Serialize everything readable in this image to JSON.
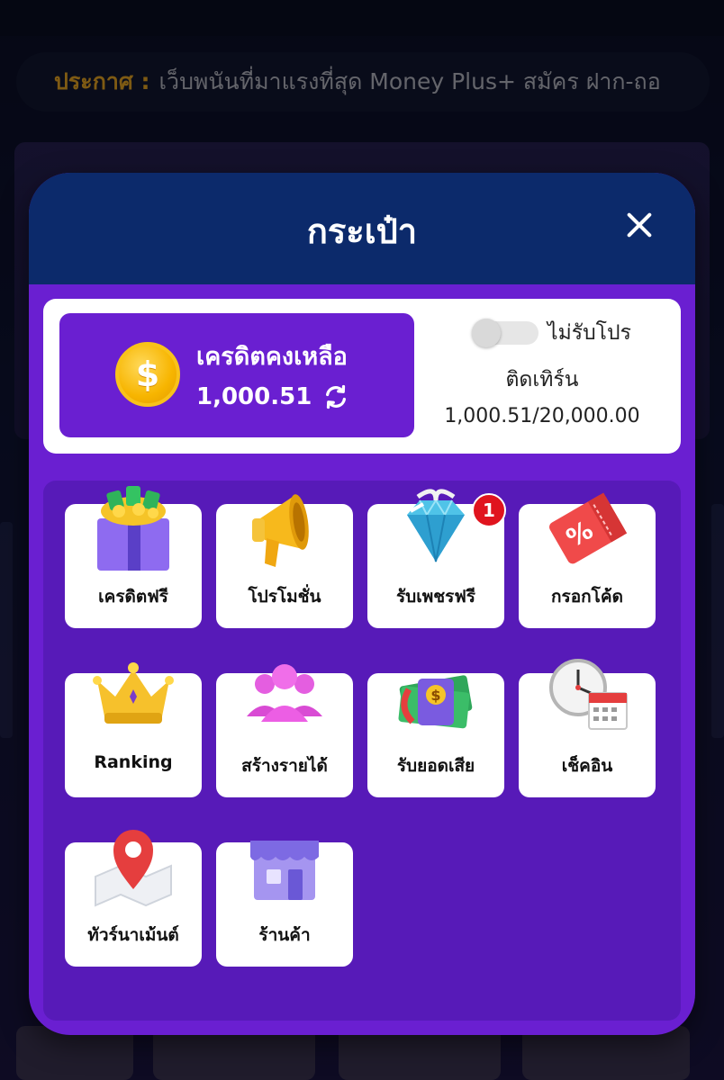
{
  "announcement": {
    "label": "ประกาศ :",
    "text": "เว็บพนันที่มาแรงที่สุด Money Plus+ สมัคร ฝาก-ถอ"
  },
  "wallet": {
    "title": "กระเป๋า",
    "close_icon": "close-icon",
    "credit_label": "เครดิตคงเหลือ",
    "credit_amount": "1,000.51",
    "promo_toggle_label": "ไม่รับโปร",
    "promo_toggle_on": false,
    "turnover_label": "ติดเทิร์น",
    "turnover_value": "1,000.51/20,000.00"
  },
  "menu": [
    {
      "label": "เครดิตฟรี",
      "icon": "gift-box-icon"
    },
    {
      "label": "โปรโมชั่น",
      "icon": "megaphone-icon"
    },
    {
      "label": "รับเพชรฟรี",
      "icon": "diamond-gift-icon",
      "badge": "1"
    },
    {
      "label": "กรอกโค้ด",
      "icon": "coupon-icon"
    },
    {
      "label": "Ranking",
      "icon": "crown-icon"
    },
    {
      "label": "สร้างรายได้",
      "icon": "users-icon"
    },
    {
      "label": "รับยอดเสีย",
      "icon": "cash-refund-icon"
    },
    {
      "label": "เช็คอิน",
      "icon": "clock-calendar-icon"
    },
    {
      "label": "ทัวร์นาเม้นต์",
      "icon": "map-pin-icon"
    },
    {
      "label": "ร้านค้า",
      "icon": "store-icon"
    }
  ],
  "colors": {
    "header": "#0c2a6b",
    "modal_bg": "#6a1fd1",
    "menu_bg": "#571ab8",
    "badge": "#e0141e",
    "announce_label": "#e5a524"
  }
}
